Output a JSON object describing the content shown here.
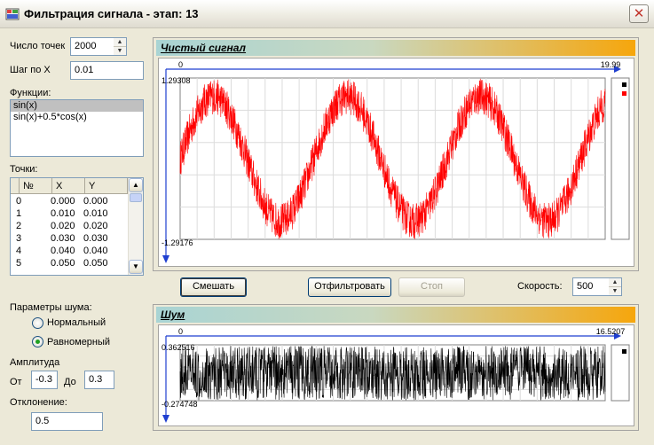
{
  "window": {
    "title": "Фильтрация сигнала - этап: 13",
    "close_glyph": "✕",
    "icon": "app-icon"
  },
  "controls": {
    "points_label": "Число точек",
    "points_value": "2000",
    "step_label": "Шаг по X",
    "step_value": "0.01",
    "functions_label": "Функции:",
    "functions": [
      "sin(x)",
      "sin(x)+0.5*cos(x)"
    ],
    "selected_function": "sin(x)",
    "grid_label": "Точки:",
    "grid_columns": [
      "№",
      "X",
      "Y"
    ],
    "grid_rows": [
      [
        "0",
        "0.000",
        "0.000"
      ],
      [
        "1",
        "0.010",
        "0.010"
      ],
      [
        "2",
        "0.020",
        "0.020"
      ],
      [
        "3",
        "0.030",
        "0.030"
      ],
      [
        "4",
        "0.040",
        "0.040"
      ],
      [
        "5",
        "0.050",
        "0.050"
      ]
    ],
    "noise_params_label": "Параметры шума:",
    "noise_types": [
      {
        "label": "Нормальный",
        "selected": false
      },
      {
        "label": "Равномерный",
        "selected": true
      }
    ],
    "amplitude_label": "Амплитуда",
    "from_label": "От",
    "from_value": "-0.3",
    "to_label": "До",
    "to_value": "0.3",
    "deviation_label": "Отклонение:",
    "deviation_value": "0.5"
  },
  "buttons": {
    "mix": "Смешать",
    "filter": "Отфильтровать",
    "stop": "Стоп",
    "speed_label": "Скорость:",
    "speed_value": "500"
  },
  "signal_panel": {
    "title": "Чистый сигнал"
  },
  "noise_panel": {
    "title": "Шум"
  },
  "chart_data": [
    {
      "type": "line",
      "title": "Чистый сигнал",
      "function": "sin(x)",
      "x_range": [
        0,
        19.99
      ],
      "y_range": [
        -1.29176,
        1.29308
      ],
      "x_min_label": "0",
      "x_max_label": "19.99",
      "y_max_label": "1.29308",
      "y_min_label": "-1.29176",
      "points": 2000,
      "x_step": 0.01,
      "noise_range": [
        -0.3,
        0.3
      ],
      "grid": true,
      "series": [
        {
          "color": "#ff0000"
        }
      ],
      "legend_colors": [
        "#000000",
        "#ff0000"
      ]
    },
    {
      "type": "line",
      "title": "Шум",
      "x_range": [
        0,
        16.5207
      ],
      "y_range": [
        -0.274748,
        0.362516
      ],
      "x_min_label": "0",
      "x_max_label": "16.5207",
      "y_max_label": "0.362516",
      "y_min_label": "-0.274748",
      "grid": true,
      "series": [
        {
          "color": "#000000"
        }
      ],
      "legend_colors": [
        "#000000"
      ]
    }
  ]
}
